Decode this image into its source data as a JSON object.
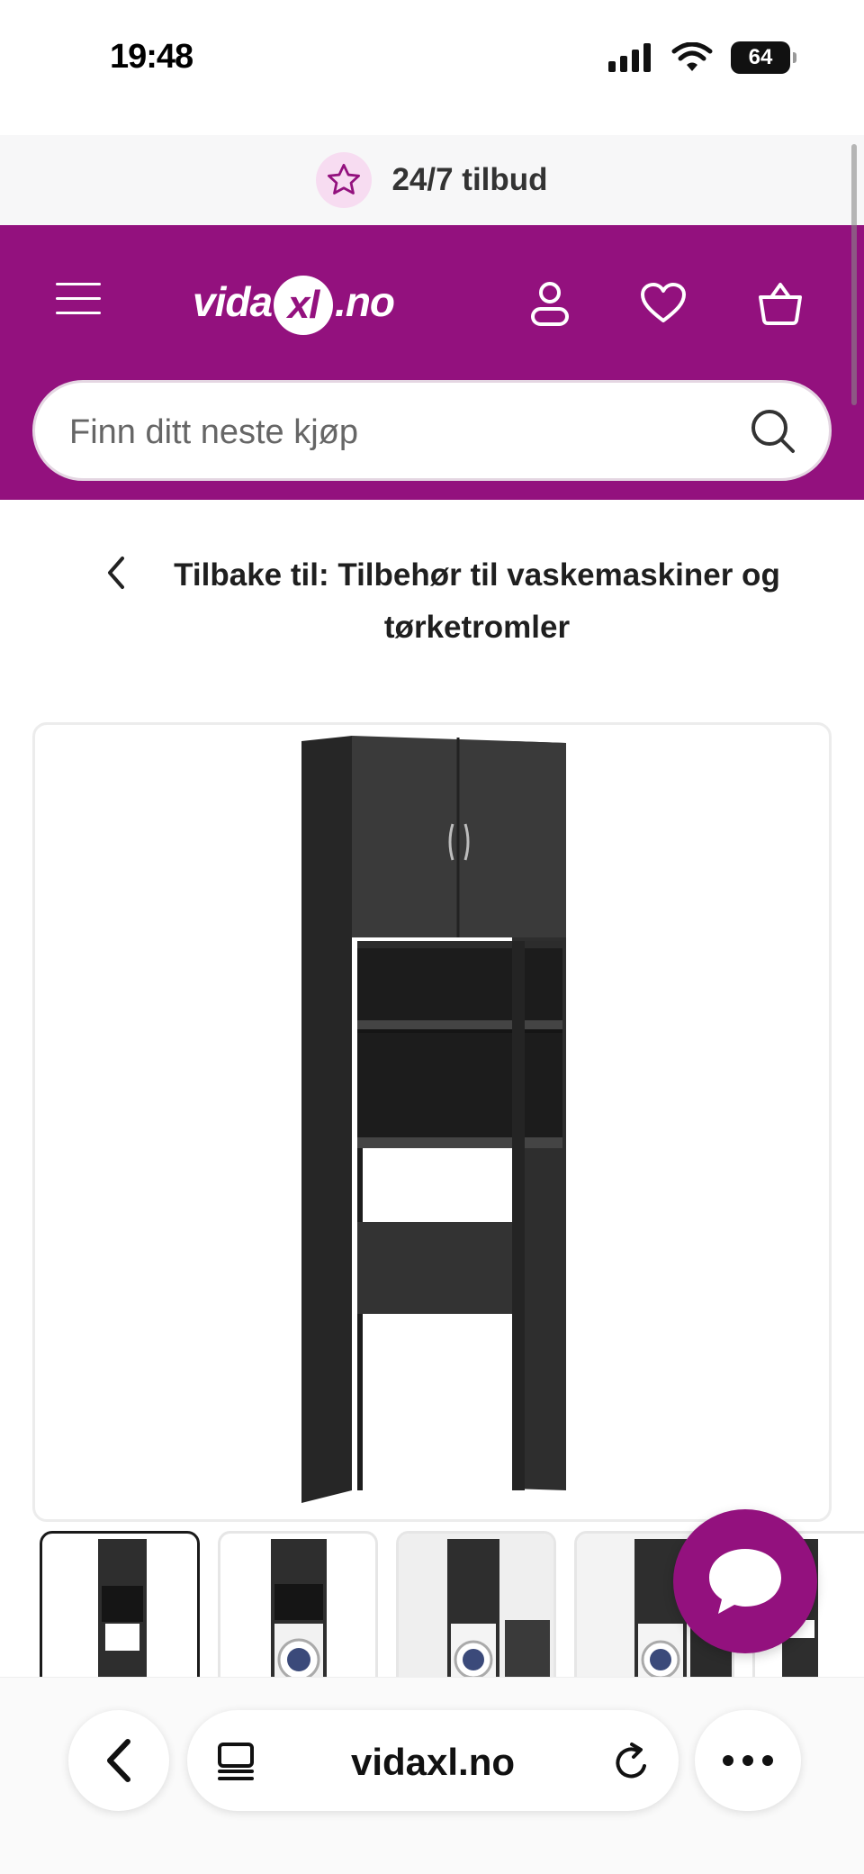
{
  "status_bar": {
    "time": "19:48",
    "battery": "64"
  },
  "promo": {
    "text": "24/7 tilbud",
    "icon": "star-icon"
  },
  "header": {
    "brand_color": "#93117e",
    "logo": {
      "pre": "vida",
      "mark": "xl",
      "post": ".no"
    },
    "icons": [
      "menu-icon",
      "user-icon",
      "heart-icon",
      "basket-icon"
    ]
  },
  "search": {
    "placeholder": "Finn ditt neste kjøp"
  },
  "breadcrumb": {
    "text": "Tilbake til: Tilbehør til vaskemaskiner og tørketromler"
  },
  "gallery": {
    "main_image": "black washing machine cabinet",
    "thumbnails": [
      {
        "label": "cabinet front view",
        "active": true
      },
      {
        "label": "cabinet with washing machine",
        "active": false
      },
      {
        "label": "cabinet in laundry room",
        "active": false
      },
      {
        "label": "cabinet styled",
        "active": false
      },
      {
        "label": "cabinet detail",
        "active": false
      }
    ]
  },
  "browser": {
    "url": "vidaxl.no"
  }
}
